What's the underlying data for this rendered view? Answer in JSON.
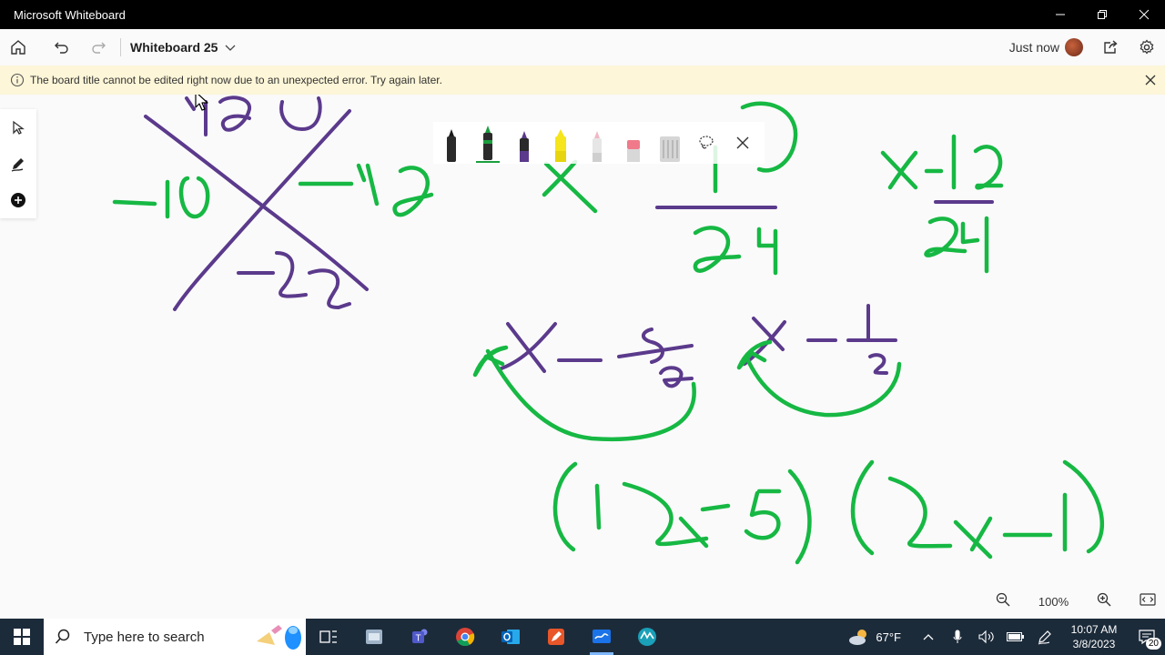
{
  "window": {
    "title": "Microsoft Whiteboard"
  },
  "appbar": {
    "board_title": "Whiteboard 25",
    "save_status": "Just now"
  },
  "banner": {
    "message": "The board title cannot be edited right now due to an unexpected error. Try again later."
  },
  "pens": [
    {
      "name": "black-pen",
      "color": "#1a1a1a"
    },
    {
      "name": "green-pen",
      "color": "#1b9e3e"
    },
    {
      "name": "purple-pen",
      "color": "#5b3a8c"
    },
    {
      "name": "yellow-highlighter",
      "color": "#f5e51a"
    },
    {
      "name": "pink-highlighter",
      "color": "#f2b8c6"
    },
    {
      "name": "eraser",
      "color": "#f07a8a"
    },
    {
      "name": "ruler",
      "color": "#bdbdbd"
    }
  ],
  "colors": {
    "ink_purple": "#5b3a8c",
    "ink_green": "#16b843",
    "banner_bg": "#fdf6d8",
    "taskbar_bg": "#1c2b3a"
  },
  "zoom": {
    "level": "100%"
  },
  "taskbar": {
    "search_placeholder": "Type here to search",
    "weather": "67°F",
    "time": "10:07 AM",
    "date": "3/8/2023",
    "notifications": "20"
  }
}
